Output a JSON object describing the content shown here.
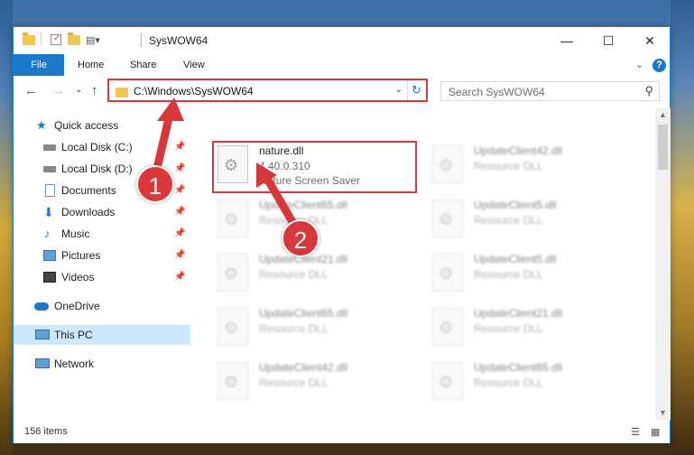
{
  "window": {
    "title": "SysWOW64",
    "minimize_glyph": "—",
    "maximize_glyph": "☐",
    "close_glyph": "✕"
  },
  "ribbon": {
    "tabs": [
      "File",
      "Home",
      "Share",
      "View"
    ],
    "expand_glyph": "⌄",
    "help_glyph": "?"
  },
  "nav": {
    "back_glyph": "←",
    "forward_glyph": "→",
    "recent_glyph": "⌄",
    "up_glyph": "↑"
  },
  "address": {
    "path": "C:\\Windows\\SysWOW64",
    "dropdown_glyph": "⌄",
    "refresh_glyph": "↻"
  },
  "search": {
    "placeholder": "Search SysWOW64",
    "icon": "search-icon",
    "glyph": "⚲"
  },
  "sidebar": {
    "items": [
      {
        "label": "Quick access",
        "icon": "star-icon",
        "pinned": false
      },
      {
        "label": "Local Disk (C:)",
        "icon": "drive-icon",
        "pinned": true
      },
      {
        "label": "Local Disk (D:)",
        "icon": "drive-icon",
        "pinned": true
      },
      {
        "label": "Documents",
        "icon": "documents-icon",
        "pinned": true
      },
      {
        "label": "Downloads",
        "icon": "download-icon",
        "pinned": true
      },
      {
        "label": "Music",
        "icon": "music-icon",
        "pinned": true
      },
      {
        "label": "Pictures",
        "icon": "pictures-icon",
        "pinned": true
      },
      {
        "label": "Videos",
        "icon": "videos-icon",
        "pinned": true
      },
      {
        "label": "OneDrive",
        "icon": "onedrive-icon",
        "pinned": false
      },
      {
        "label": "This PC",
        "icon": "pc-icon",
        "pinned": false,
        "selected": true
      },
      {
        "label": "Network",
        "icon": "network-icon",
        "pinned": false
      }
    ]
  },
  "files": {
    "highlighted": {
      "name": "nature.dll",
      "version": "4.40.0.310",
      "description": "Nature Screen Saver"
    },
    "items": [
      {
        "name": "UpdateClient42.dll",
        "type": "Resource DLL"
      },
      {
        "name": "UpdateClient65.dll",
        "type": "Resource DLL"
      },
      {
        "name": "UpdateClient5.dll",
        "type": "Resource DLL"
      },
      {
        "name": "UpdateClient21.dll",
        "type": "Resource DLL"
      },
      {
        "name": "UpdateClient5.dll",
        "type": "Resource DLL"
      },
      {
        "name": "UpdateClient65.dll",
        "type": "Resource DLL"
      },
      {
        "name": "UpdateClient21.dll",
        "type": "Resource DLL"
      },
      {
        "name": "UpdateClient42.dll",
        "type": "Resource DLL"
      },
      {
        "name": "UpdateClient65.dll",
        "type": "Resource DLL"
      }
    ]
  },
  "status": {
    "item_count": "156 items"
  },
  "callouts": [
    "1",
    "2"
  ],
  "colors": {
    "accent": "#1979ca",
    "highlight": "#d9383a",
    "selected": "#cce8ff"
  }
}
